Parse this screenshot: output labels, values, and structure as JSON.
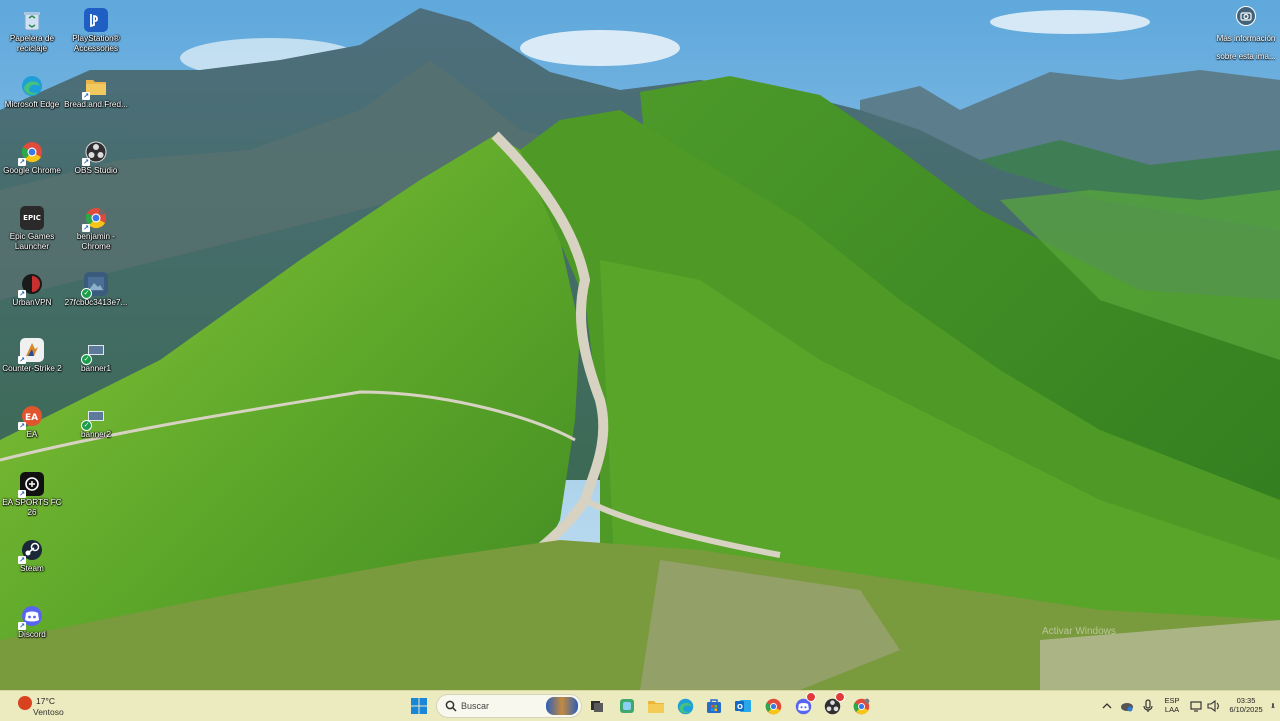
{
  "desktop": {
    "icons": [
      {
        "label": "Papelera de reciclaje",
        "icon": "recycle-bin-icon",
        "color": "#6fa7d8"
      },
      {
        "label": "PlayStation® Accessories",
        "icon": "playstation-icon",
        "color": "#1f5fc4"
      },
      {
        "label": "Microsoft Edge",
        "icon": "edge-icon",
        "color": "#1f9fd8"
      },
      {
        "label": "Bread.and.Fred...",
        "icon": "folder-icon",
        "color": "#e8b64a"
      },
      {
        "label": "Google Chrome",
        "icon": "chrome-icon",
        "color": "#e14b3b"
      },
      {
        "label": "OBS Studio",
        "icon": "obs-icon",
        "color": "#302e31"
      },
      {
        "label": "Epic Games Launcher",
        "icon": "epic-games-icon",
        "color": "#2a2a2a"
      },
      {
        "label": "benjamin - Chrome",
        "icon": "chrome-profile-icon",
        "color": "#e14b3b"
      },
      {
        "label": "UrbanVPN",
        "icon": "urbanvpn-icon",
        "color": "#c8302f"
      },
      {
        "label": "27fcb0c3413e7...",
        "icon": "image-file-icon",
        "color": "#3b5b7c"
      },
      {
        "label": "Counter-Strike 2",
        "icon": "counter-strike-icon",
        "color": "#d88a2a"
      },
      {
        "label": "banner1",
        "icon": "image-file-icon",
        "color": "#5d7a9a"
      },
      {
        "label": "EA",
        "icon": "ea-icon",
        "color": "#e0552e"
      },
      {
        "label": "banner2",
        "icon": "image-file-icon",
        "color": "#5d7a9a"
      },
      {
        "label": "EA SPORTS FC 26",
        "icon": "ea-sports-fc-icon",
        "color": "#1a1a1a"
      },
      {
        "label": "Steam",
        "icon": "steam-icon",
        "color": "#1b2838"
      },
      {
        "label": "Discord",
        "icon": "discord-icon",
        "color": "#5865f2"
      }
    ],
    "info_label": "Más información sobre esta ima...",
    "activate_text": "Activar Windows"
  },
  "taskbar": {
    "weather": {
      "temp": "17°C",
      "condition": "Ventoso"
    },
    "search": {
      "placeholder": "Buscar"
    },
    "apps": [
      {
        "icon": "task-view-icon",
        "color": "#2f2f2f"
      },
      {
        "icon": "copilot-icon",
        "color": "#3fa86f"
      },
      {
        "icon": "file-explorer-icon",
        "color": "#e9b53a"
      },
      {
        "icon": "edge-icon",
        "color": "#1f9fd8"
      },
      {
        "icon": "microsoft-store-icon",
        "color": "#2a6ac9"
      },
      {
        "icon": "outlook-icon",
        "color": "#1468c1"
      },
      {
        "icon": "chrome-icon",
        "color": "#e14b3b"
      },
      {
        "icon": "discord-icon",
        "color": "#5865f2"
      },
      {
        "icon": "obs-icon",
        "color": "#302e31"
      },
      {
        "icon": "chrome-profile-icon",
        "color": "#e14b3b"
      }
    ],
    "tray": {
      "lang_top": "ESP",
      "lang_bottom": "LAA",
      "time": "03:35",
      "date": "6/10/2025"
    }
  }
}
